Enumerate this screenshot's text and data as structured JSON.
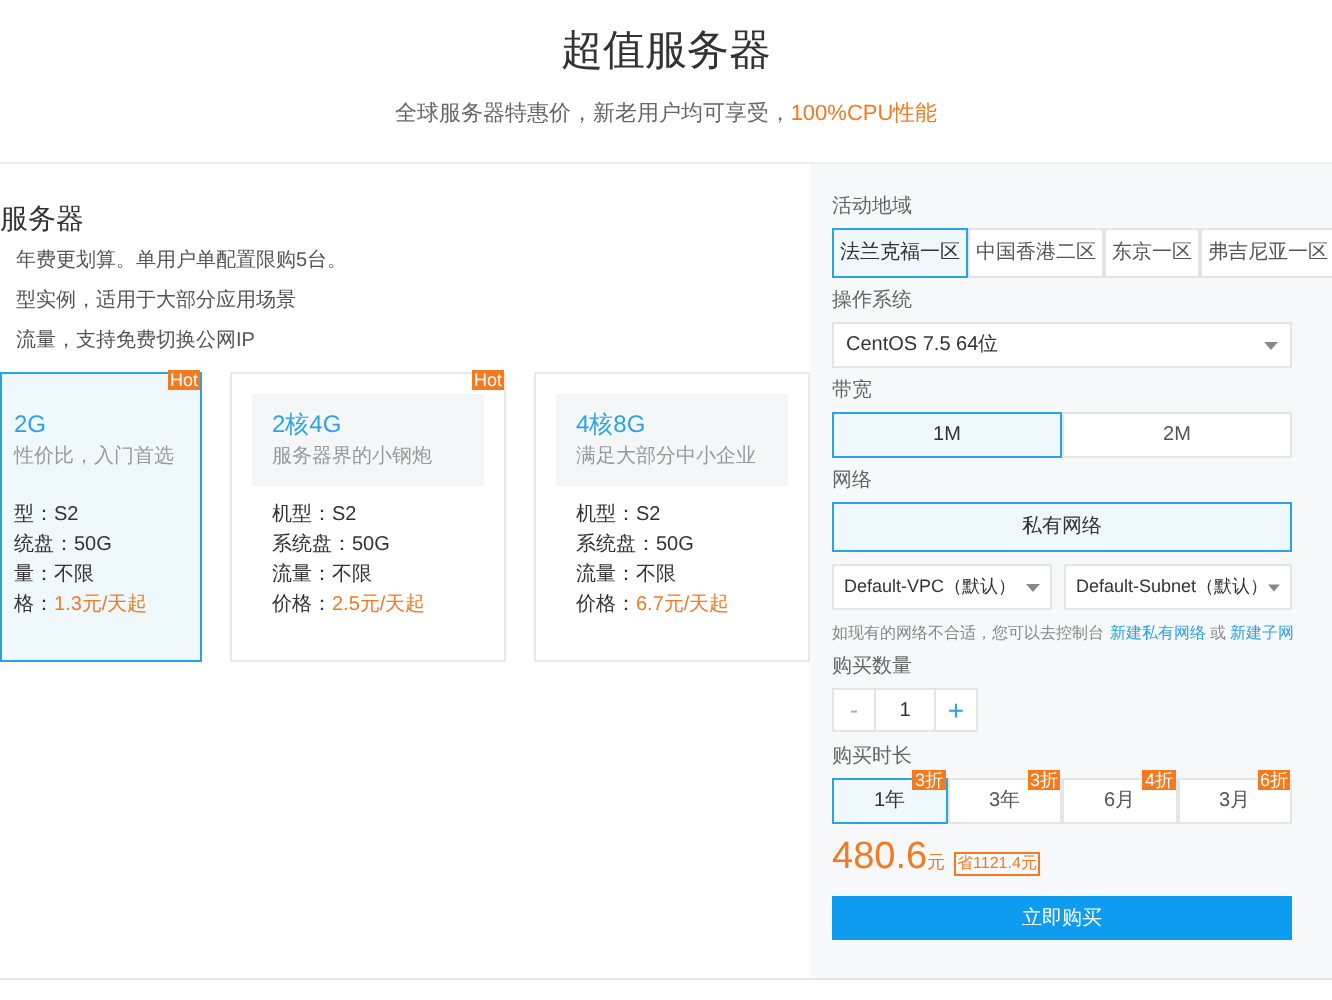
{
  "header": {
    "title": "超值服务器",
    "subtitle": "全球服务器特惠价，新老用户均可享受，",
    "subtitle_highlight": "100%CPU性能"
  },
  "intro": {
    "title": "服务器",
    "lines": [
      "年费更划算。单用户单配置限购5台。",
      "型实例，适用于大部分应用场景",
      "流量，支持免费切换公网IP"
    ]
  },
  "plans": [
    {
      "name": "2G",
      "tagline": "性价比，入门首选",
      "selected": true,
      "specs": [
        {
          "label": "型：",
          "value": "S2"
        },
        {
          "label": "统盘：",
          "value": "50G"
        },
        {
          "label": "量：",
          "value": "不限"
        }
      ],
      "price_label": "格：",
      "price": "1.3元/天起",
      "badge": "Hot"
    },
    {
      "name": "2核4G",
      "tagline": "服务器界的小钢炮",
      "selected": false,
      "specs": [
        {
          "label": "机型：",
          "value": "S2"
        },
        {
          "label": "系统盘：",
          "value": "50G"
        },
        {
          "label": "流量：",
          "value": "不限"
        }
      ],
      "price_label": "价格：",
      "price": "2.5元/天起",
      "badge": "Hot"
    },
    {
      "name": "4核8G",
      "tagline": "满足大部分中小企业",
      "selected": false,
      "specs": [
        {
          "label": "机型：",
          "value": "S2"
        },
        {
          "label": "系统盘：",
          "value": "50G"
        },
        {
          "label": "流量：",
          "value": "不限"
        }
      ],
      "price_label": "价格：",
      "price": "6.7元/天起"
    }
  ],
  "config": {
    "region_label": "活动地域",
    "regions": [
      {
        "label": "法兰克福一区",
        "selected": true
      },
      {
        "label": "中国香港二区",
        "selected": false
      },
      {
        "label": "东京一区",
        "selected": false
      },
      {
        "label": "弗吉尼亚一区",
        "selected": false
      }
    ],
    "os_label": "操作系统",
    "os": "CentOS 7.5 64位",
    "bandwidth_label": "带宽",
    "bandwidths": [
      {
        "label": "1M",
        "selected": true
      },
      {
        "label": "2M",
        "selected": false
      }
    ],
    "network_label": "网络",
    "networks": [
      {
        "label": "私有网络",
        "selected": true
      }
    ],
    "vpc": "Default-VPC（默认）",
    "subnet": "Default-Subnet（默认）",
    "network_hint": "如现有的网络不合适，您可以去控制台",
    "link_vpc": "新建私有网络",
    "hint_or": "或",
    "link_subnet": "新建子网",
    "quantity_label": "购买数量",
    "minus": "-",
    "quantity": "1",
    "plus": "+",
    "duration_label": "购买时长",
    "durations": [
      {
        "label": "1年",
        "badge": "3折",
        "selected": true
      },
      {
        "label": "3年",
        "badge": "3折",
        "selected": false
      },
      {
        "label": "6月",
        "badge": "4折",
        "selected": false
      },
      {
        "label": "3月",
        "badge": "6折",
        "selected": false
      }
    ],
    "price": "480.6",
    "price_unit": "元",
    "saving": "省1121.4元",
    "buy_button": "立即购买"
  }
}
